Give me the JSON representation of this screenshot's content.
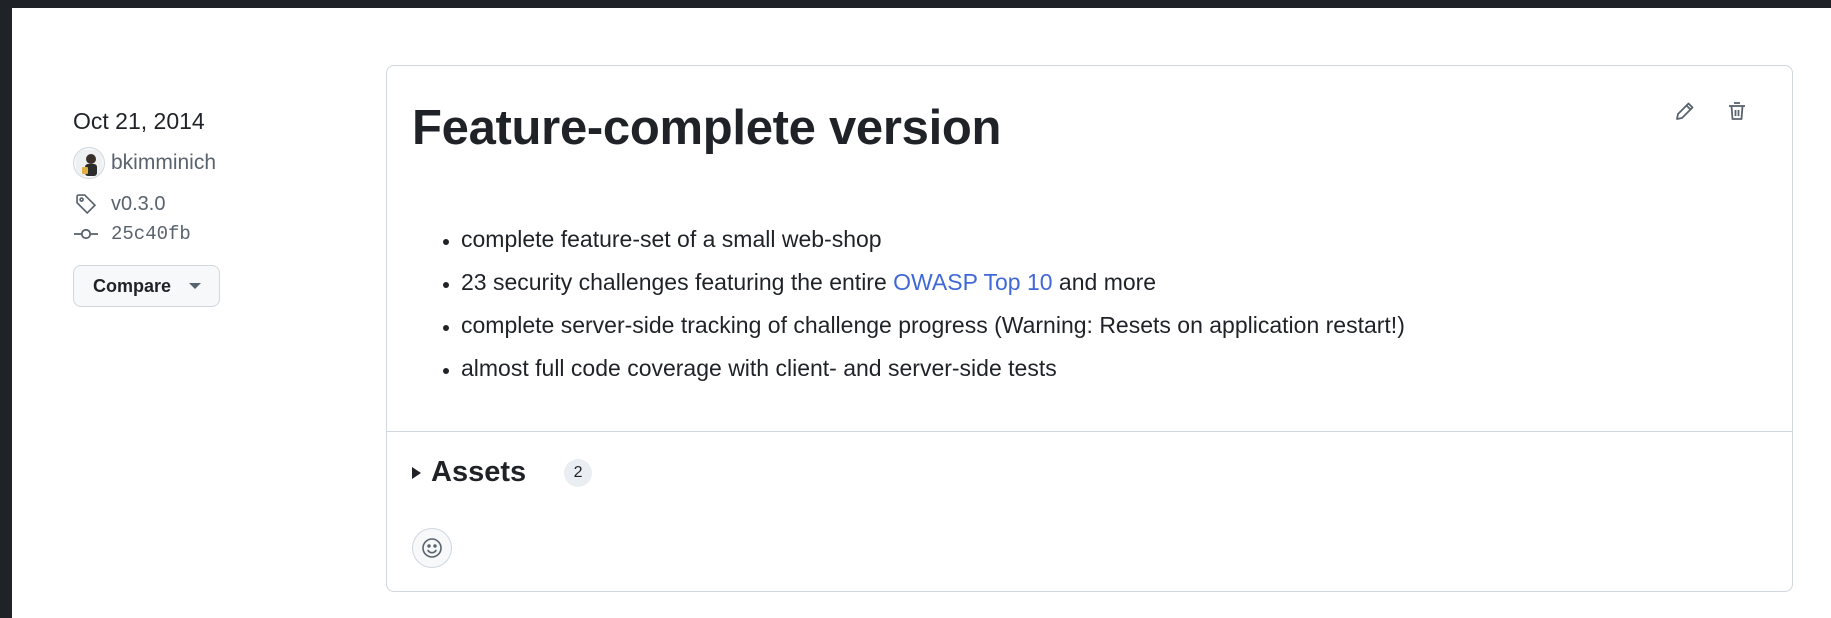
{
  "release": {
    "date": "Oct 21, 2014",
    "author": "bkimminich",
    "tag": "v0.3.0",
    "commit": "25c40fb",
    "compare_label": "Compare",
    "title": "Feature-complete version",
    "notes": {
      "item1": "complete feature-set of a small web-shop",
      "item2_prefix": "23 security challenges featuring the entire ",
      "item2_link": "OWASP Top 10",
      "item2_suffix": " and more",
      "item3": "complete server-side tracking of challenge progress (Warning: Resets on application restart!)",
      "item4": "almost full code coverage with client- and server-side tests"
    },
    "assets_label": "Assets",
    "assets_count": "2"
  },
  "icons": {
    "edit": "pencil-icon",
    "delete": "trash-icon",
    "tag": "tag-icon",
    "commit": "git-commit-icon",
    "reaction": "smiley-icon"
  },
  "colors": {
    "link": "#4169d6",
    "muted": "#59636e",
    "border": "#d0d7de"
  }
}
